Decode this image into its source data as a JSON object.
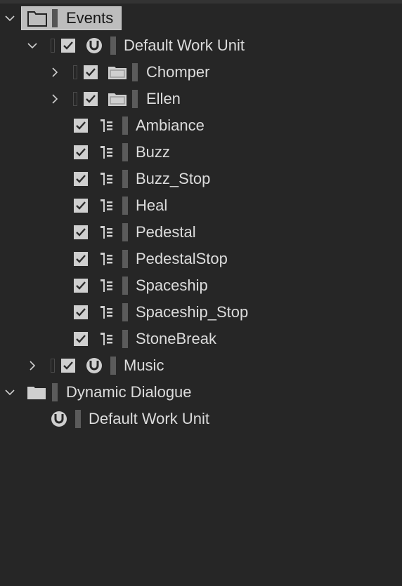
{
  "tree": {
    "root": {
      "label": "Events",
      "expanded": true,
      "selected": true
    },
    "default_work_unit": {
      "label": "Default Work Unit",
      "expanded": true,
      "checked": true
    },
    "folders": [
      {
        "label": "Chomper",
        "expanded": false,
        "checked": true
      },
      {
        "label": "Ellen",
        "expanded": false,
        "checked": true
      }
    ],
    "events": [
      {
        "label": "Ambiance",
        "checked": true
      },
      {
        "label": "Buzz",
        "checked": true
      },
      {
        "label": "Buzz_Stop",
        "checked": true
      },
      {
        "label": "Heal",
        "checked": true
      },
      {
        "label": "Pedestal",
        "checked": true
      },
      {
        "label": "PedestalStop",
        "checked": true
      },
      {
        "label": "Spaceship",
        "checked": true
      },
      {
        "label": "Spaceship_Stop",
        "checked": true
      },
      {
        "label": "StoneBreak",
        "checked": true
      }
    ],
    "music": {
      "label": "Music",
      "expanded": false,
      "checked": true
    },
    "dynamic_dialogue": {
      "label": "Dynamic Dialogue",
      "expanded": true
    },
    "dialogue_work_unit": {
      "label": "Default Work Unit"
    }
  },
  "colors": {
    "background": "#262626",
    "text": "#dcdcdc",
    "icon": "#cfcfcf",
    "selection": "#bdbdbd"
  }
}
